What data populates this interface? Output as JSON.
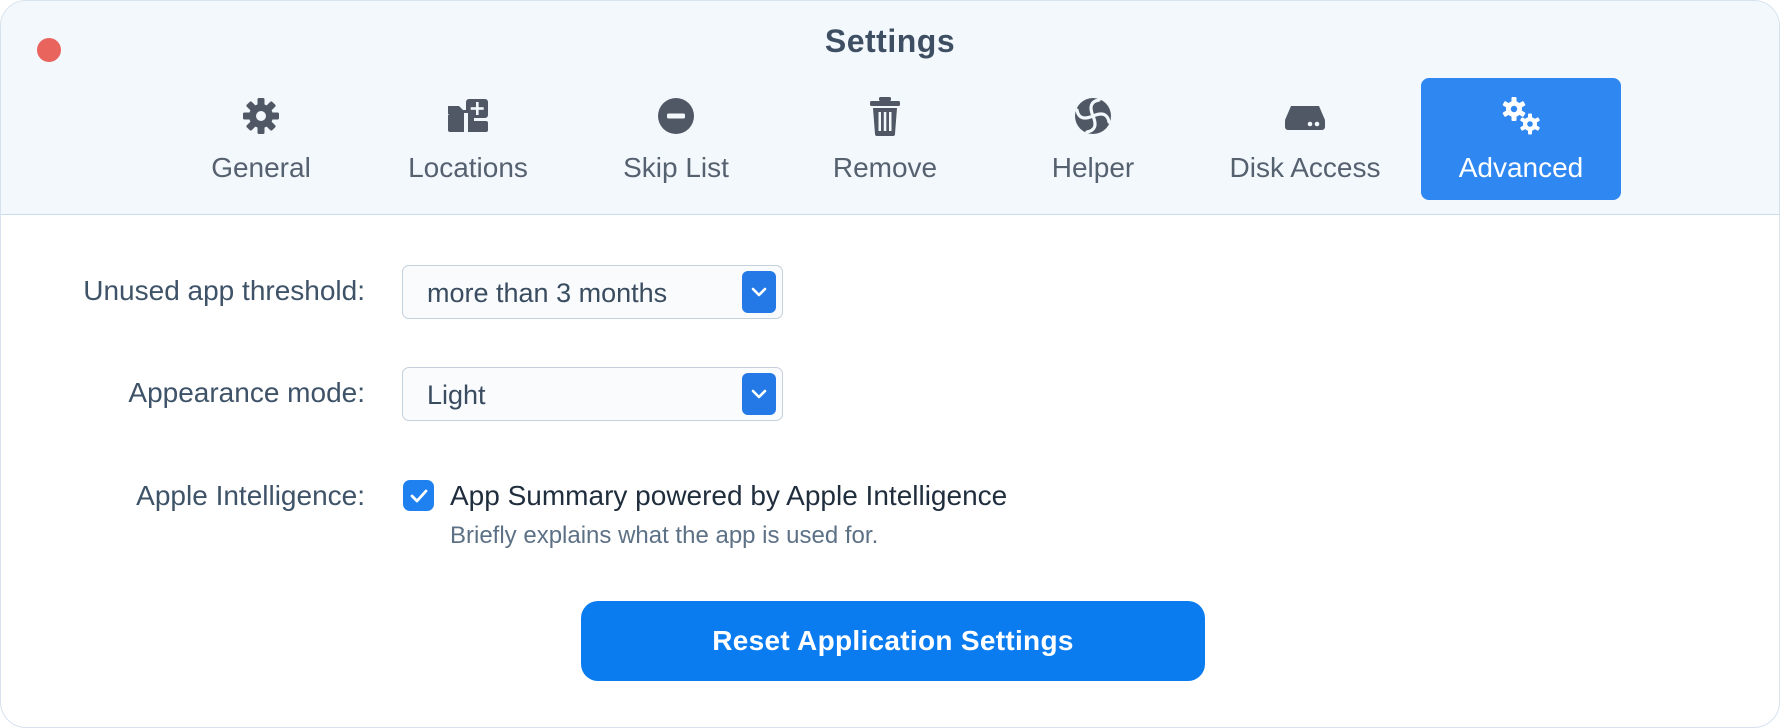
{
  "window": {
    "title": "Settings"
  },
  "tabs": [
    {
      "label": "General",
      "icon": "gear-icon"
    },
    {
      "label": "Locations",
      "icon": "folder-plus-icon"
    },
    {
      "label": "Skip List",
      "icon": "minus-circle-icon"
    },
    {
      "label": "Remove",
      "icon": "trash-icon"
    },
    {
      "label": "Helper",
      "icon": "helper-swirl-icon"
    },
    {
      "label": "Disk Access",
      "icon": "disk-drive-icon"
    },
    {
      "label": "Advanced",
      "icon": "gears-icon",
      "active": true
    }
  ],
  "settings": {
    "unused_threshold": {
      "label": "Unused app threshold:",
      "value": "more than 3 months"
    },
    "appearance": {
      "label": "Appearance mode:",
      "value": "Light"
    },
    "apple_intelligence": {
      "label": "Apple Intelligence:",
      "checkbox_checked": true,
      "checkbox_label": "App Summary powered by Apple Intelligence",
      "description": "Briefly explains what the app is used for."
    }
  },
  "reset_button_label": "Reset Application Settings",
  "colors": {
    "accent": "#0a7cf0",
    "close_button": "#e9645c",
    "titlebar_bg": "#f3f8fd"
  }
}
